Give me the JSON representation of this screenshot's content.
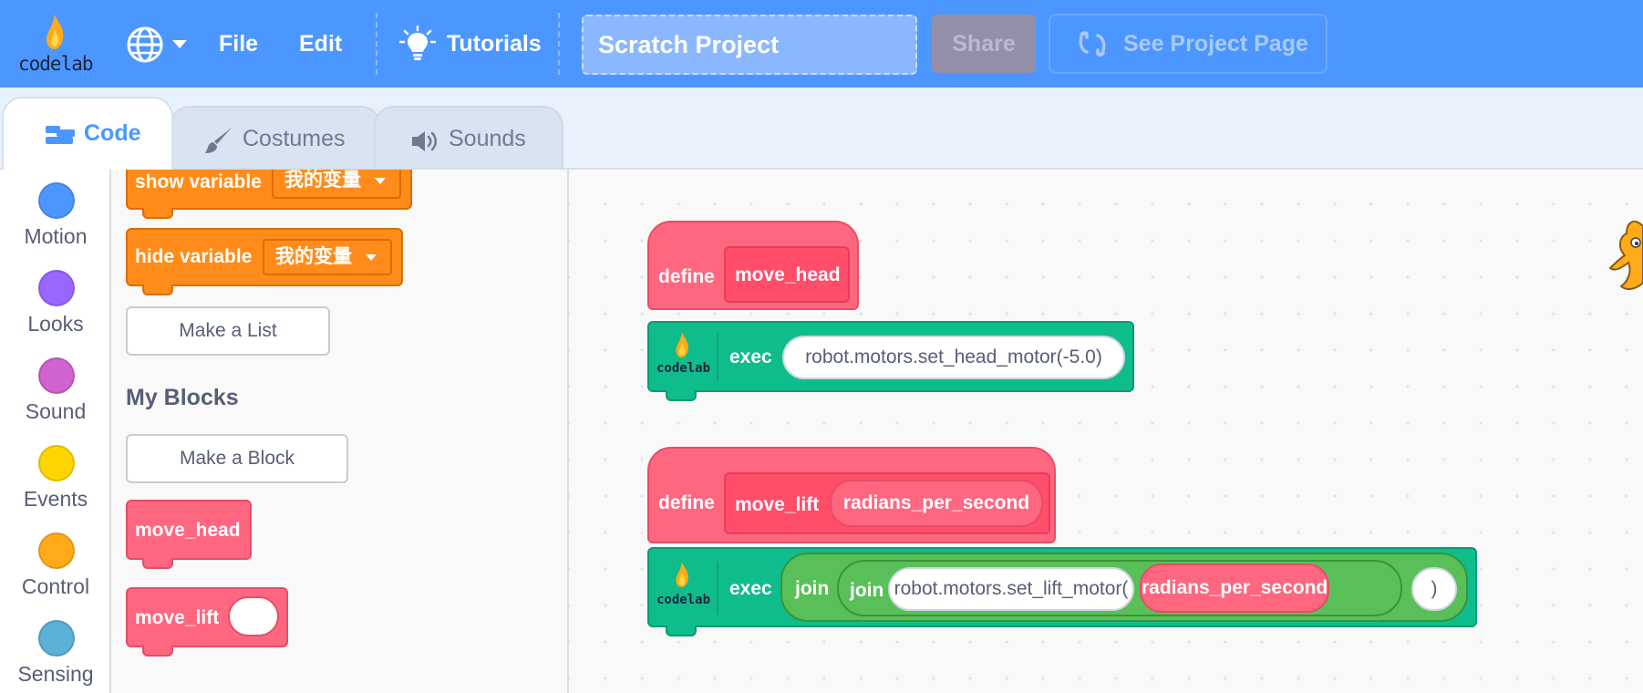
{
  "menubar": {
    "logo_text": "codelab",
    "file": "File",
    "edit": "Edit",
    "tutorials": "Tutorials",
    "project_title": "Scratch Project",
    "share": "Share",
    "see_project_page": "See Project Page",
    "colors": {
      "bar": "#4c97ff"
    }
  },
  "tabs": [
    {
      "label": "Code",
      "icon": "code-icon",
      "active": true
    },
    {
      "label": "Costumes",
      "icon": "brush-icon",
      "active": false
    },
    {
      "label": "Sounds",
      "icon": "speaker-icon",
      "active": false
    }
  ],
  "categories": [
    {
      "label": "Motion",
      "color": "#4c97ff"
    },
    {
      "label": "Looks",
      "color": "#9966ff"
    },
    {
      "label": "Sound",
      "color": "#cf63cf"
    },
    {
      "label": "Events",
      "color": "#ffd500"
    },
    {
      "label": "Control",
      "color": "#ffab19"
    },
    {
      "label": "Sensing",
      "color": "#5cb1d6"
    }
  ],
  "palette": {
    "show_variable": "show variable",
    "hide_variable": "hide variable",
    "variable_name": "我的变量",
    "make_list": "Make a List",
    "my_blocks_title": "My Blocks",
    "make_block": "Make a Block",
    "move_head": "move_head",
    "move_lift": "move_lift"
  },
  "scripts": {
    "define": "define",
    "exec": "exec",
    "join": "join",
    "move_head": "move_head",
    "move_lift": "move_lift",
    "radians_per_second": "radians_per_second",
    "set_head_motor": "robot.motors.set_head_motor(-5.0)",
    "set_lift_motor": "robot.motors.set_lift_motor(",
    "close_paren": ")",
    "logo_text": "codelab"
  }
}
